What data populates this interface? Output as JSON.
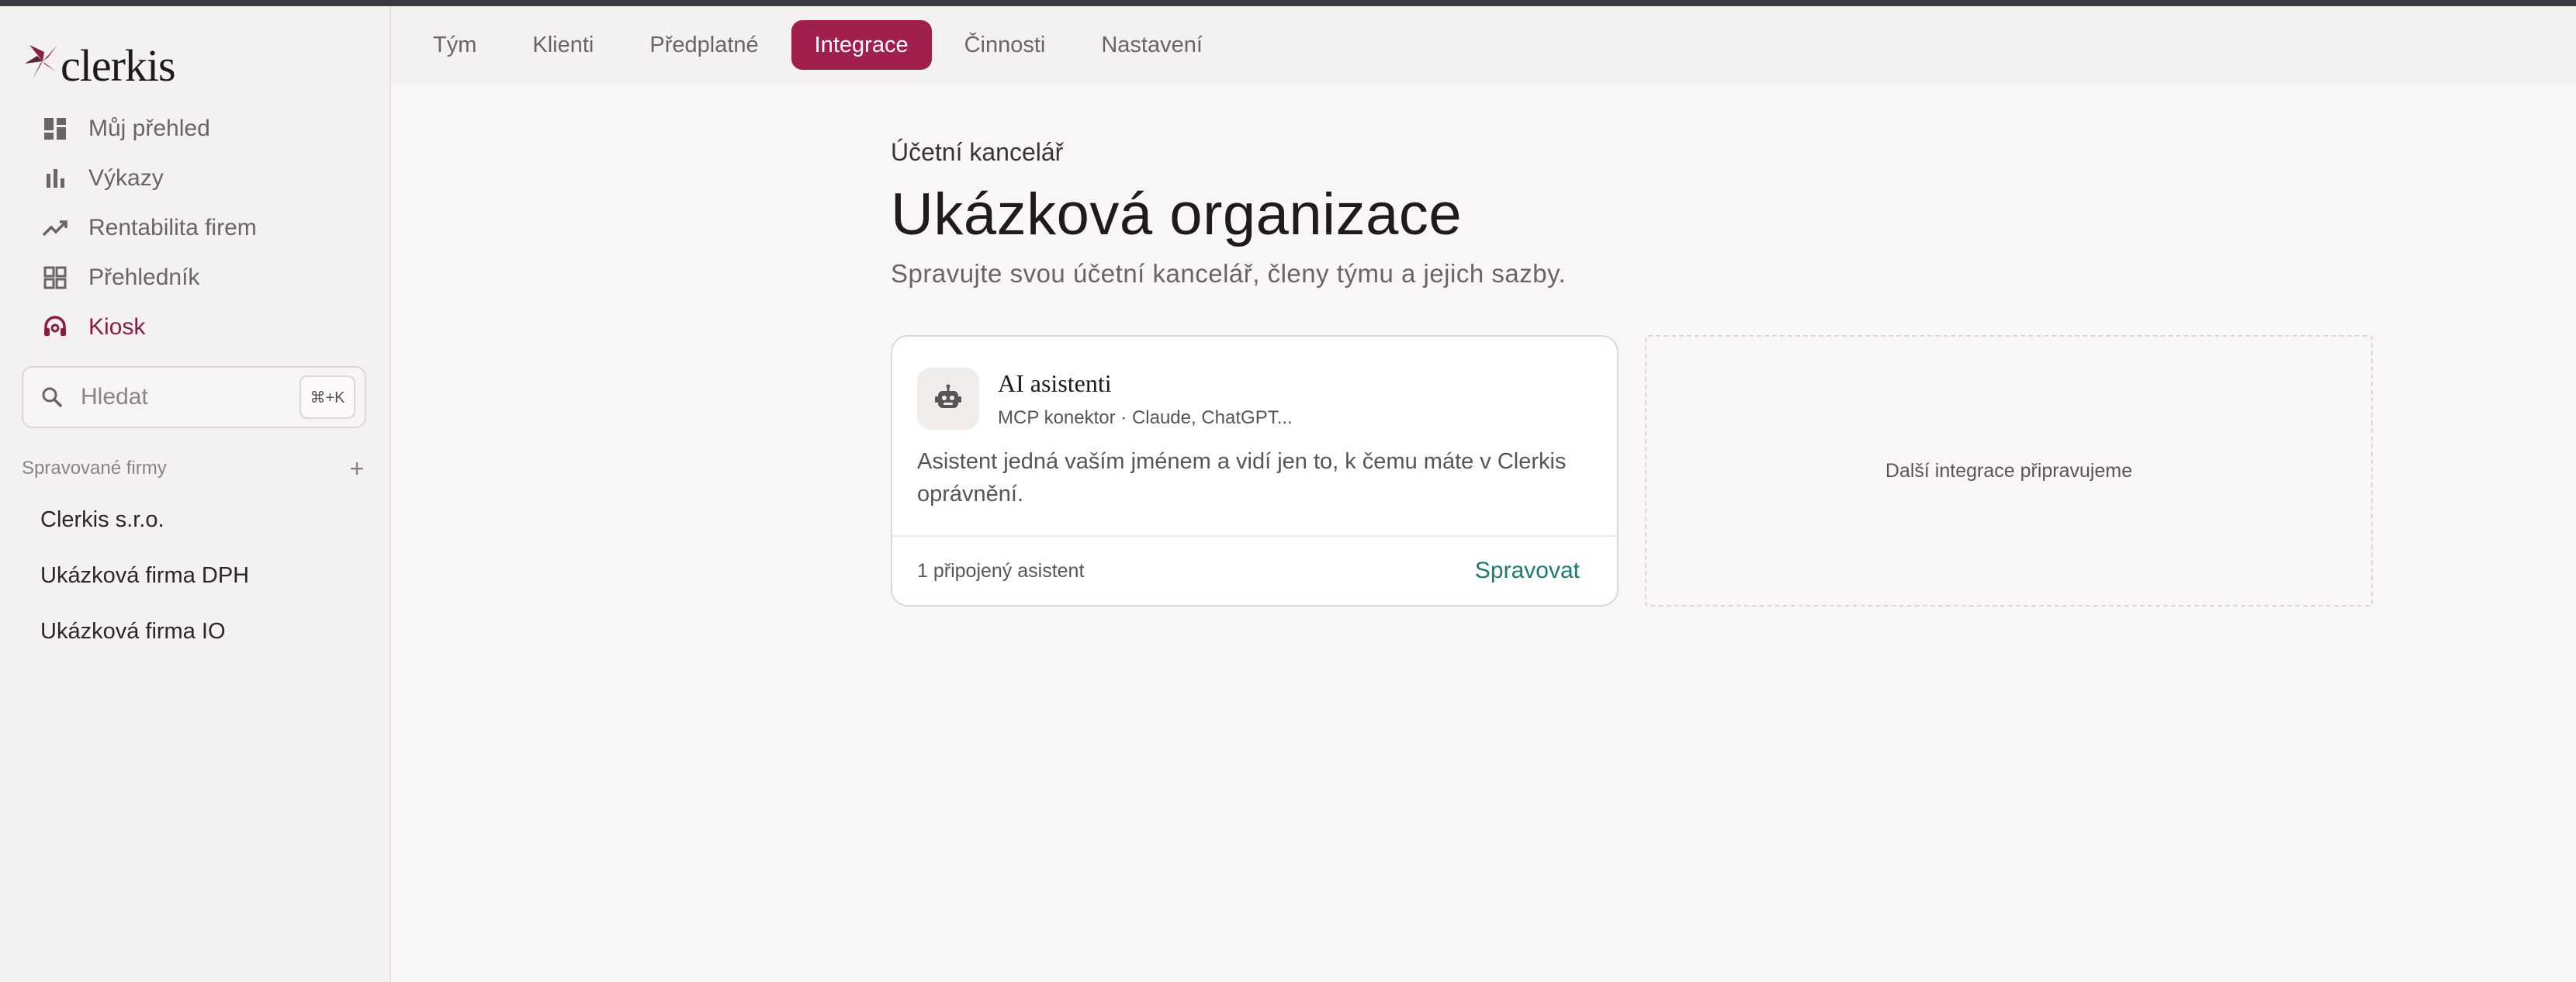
{
  "brand": {
    "name": "clerkis",
    "accent": "#a01f4c"
  },
  "sidebar": {
    "nav": [
      {
        "label": "Můj přehled",
        "icon": "dashboard-icon"
      },
      {
        "label": "Výkazy",
        "icon": "bar-chart-icon"
      },
      {
        "label": "Rentabilita firem",
        "icon": "trending-up-icon"
      },
      {
        "label": "Přehledník",
        "icon": "grid-icon"
      },
      {
        "label": "Kiosk",
        "icon": "headset-icon",
        "active": true
      }
    ],
    "search": {
      "placeholder": "Hledat",
      "shortcut": "⌘+K"
    },
    "section_title": "Spravované firmy",
    "add_label": "+",
    "firms": [
      "Clerkis s.r.o.",
      "Ukázková firma DPH",
      "Ukázková firma IO"
    ]
  },
  "tabs": [
    {
      "label": "Tým"
    },
    {
      "label": "Klienti"
    },
    {
      "label": "Předplatné"
    },
    {
      "label": "Integrace",
      "active": true
    },
    {
      "label": "Činnosti"
    },
    {
      "label": "Nastavení"
    }
  ],
  "page": {
    "eyebrow": "Účetní kancelář",
    "title": "Ukázková organizace",
    "subtitle": "Spravujte svou účetní kancelář, členy týmu a jejich sazby."
  },
  "integration_card": {
    "icon": "robot-icon",
    "title": "AI asistenti",
    "meta": "MCP konektor · Claude, ChatGPT...",
    "description": "Asistent jedná vaším jménem a vidí jen to, k čemu máte v Clerkis oprávnění.",
    "count": "1 připojený asistent",
    "action": "Spravovat"
  },
  "placeholder_text": "Další integrace připravujeme"
}
